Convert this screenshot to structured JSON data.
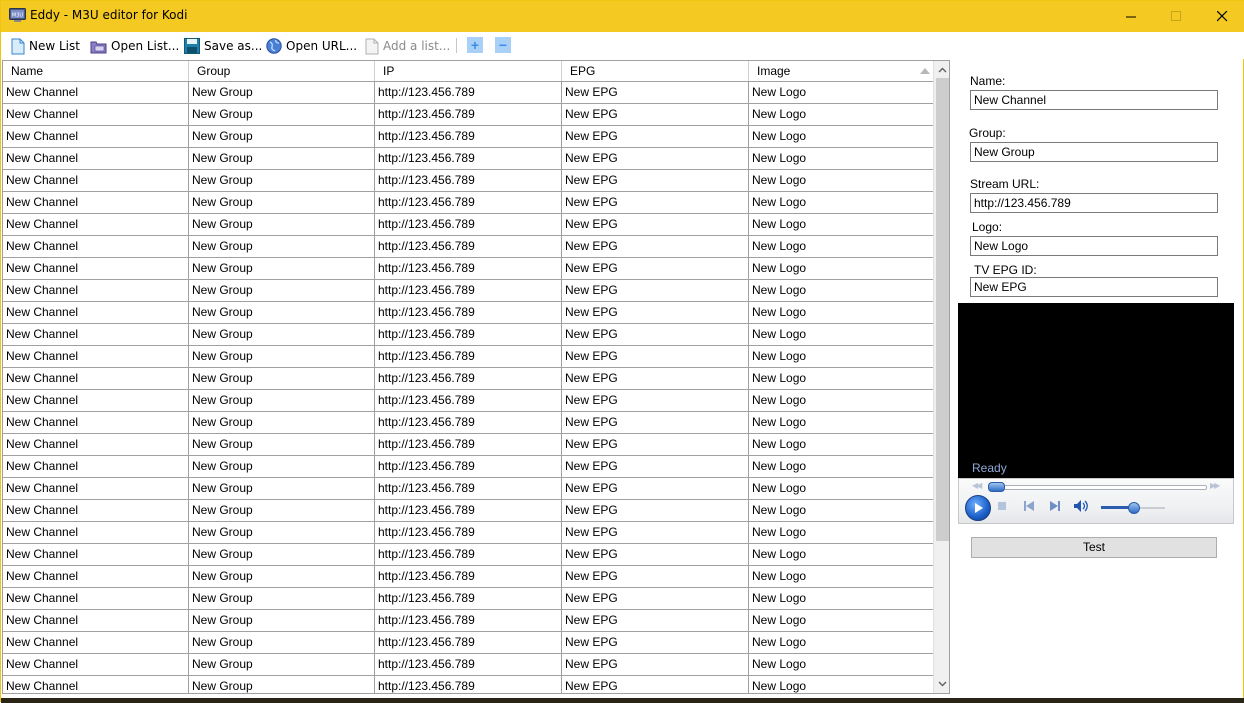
{
  "window": {
    "title": "Eddy - M3U editor for Kodi",
    "accent_color": "#f4c921",
    "controls": [
      "minimize-icon",
      "maximize-icon",
      "close-icon"
    ]
  },
  "toolbar": {
    "items": [
      {
        "label": "New List",
        "icon": "new-document-icon",
        "enabled": true
      },
      {
        "label": "Open List...",
        "icon": "open-folder-icon",
        "enabled": true
      },
      {
        "label": "Save as...",
        "icon": "floppy-disk-icon",
        "enabled": true
      },
      {
        "label": "Open URL...",
        "icon": "globe-icon",
        "enabled": true
      },
      {
        "label": "Add a list...",
        "icon": "add-document-icon",
        "enabled": false
      }
    ],
    "add_row": "+",
    "remove_row": "−"
  },
  "grid": {
    "columns": [
      "Name",
      "Group",
      "IP",
      "EPG",
      "Image"
    ],
    "sorted_column": "Image",
    "rows": [
      [
        "New Channel",
        "New Group",
        "http://123.456.789",
        "New EPG",
        "New Logo"
      ],
      [
        "New Channel",
        "New Group",
        "http://123.456.789",
        "New EPG",
        "New Logo"
      ],
      [
        "New Channel",
        "New Group",
        "http://123.456.789",
        "New EPG",
        "New Logo"
      ],
      [
        "New Channel",
        "New Group",
        "http://123.456.789",
        "New EPG",
        "New Logo"
      ],
      [
        "New Channel",
        "New Group",
        "http://123.456.789",
        "New EPG",
        "New Logo"
      ],
      [
        "New Channel",
        "New Group",
        "http://123.456.789",
        "New EPG",
        "New Logo"
      ],
      [
        "New Channel",
        "New Group",
        "http://123.456.789",
        "New EPG",
        "New Logo"
      ],
      [
        "New Channel",
        "New Group",
        "http://123.456.789",
        "New EPG",
        "New Logo"
      ],
      [
        "New Channel",
        "New Group",
        "http://123.456.789",
        "New EPG",
        "New Logo"
      ],
      [
        "New Channel",
        "New Group",
        "http://123.456.789",
        "New EPG",
        "New Logo"
      ],
      [
        "New Channel",
        "New Group",
        "http://123.456.789",
        "New EPG",
        "New Logo"
      ],
      [
        "New Channel",
        "New Group",
        "http://123.456.789",
        "New EPG",
        "New Logo"
      ],
      [
        "New Channel",
        "New Group",
        "http://123.456.789",
        "New EPG",
        "New Logo"
      ],
      [
        "New Channel",
        "New Group",
        "http://123.456.789",
        "New EPG",
        "New Logo"
      ],
      [
        "New Channel",
        "New Group",
        "http://123.456.789",
        "New EPG",
        "New Logo"
      ],
      [
        "New Channel",
        "New Group",
        "http://123.456.789",
        "New EPG",
        "New Logo"
      ],
      [
        "New Channel",
        "New Group",
        "http://123.456.789",
        "New EPG",
        "New Logo"
      ],
      [
        "New Channel",
        "New Group",
        "http://123.456.789",
        "New EPG",
        "New Logo"
      ],
      [
        "New Channel",
        "New Group",
        "http://123.456.789",
        "New EPG",
        "New Logo"
      ],
      [
        "New Channel",
        "New Group",
        "http://123.456.789",
        "New EPG",
        "New Logo"
      ],
      [
        "New Channel",
        "New Group",
        "http://123.456.789",
        "New EPG",
        "New Logo"
      ],
      [
        "New Channel",
        "New Group",
        "http://123.456.789",
        "New EPG",
        "New Logo"
      ],
      [
        "New Channel",
        "New Group",
        "http://123.456.789",
        "New EPG",
        "New Logo"
      ],
      [
        "New Channel",
        "New Group",
        "http://123.456.789",
        "New EPG",
        "New Logo"
      ],
      [
        "New Channel",
        "New Group",
        "http://123.456.789",
        "New EPG",
        "New Logo"
      ],
      [
        "New Channel",
        "New Group",
        "http://123.456.789",
        "New EPG",
        "New Logo"
      ],
      [
        "New Channel",
        "New Group",
        "http://123.456.789",
        "New EPG",
        "New Logo"
      ],
      [
        "New Channel",
        "New Group",
        "http://123.456.789",
        "New EPG",
        "New Logo"
      ]
    ]
  },
  "details": {
    "name_label": "Name:",
    "name_value": "New Channel",
    "group_label": "Group:",
    "group_value": "New Group",
    "url_label": "Stream URL:",
    "url_value": "http://123.456.789",
    "logo_label": "Logo:",
    "logo_value": "New Logo",
    "epg_label": "TV EPG ID:",
    "epg_value": "New EPG"
  },
  "player": {
    "status": "Ready",
    "seek_position": 0,
    "volume_percent": 50
  },
  "test_button": "Test"
}
